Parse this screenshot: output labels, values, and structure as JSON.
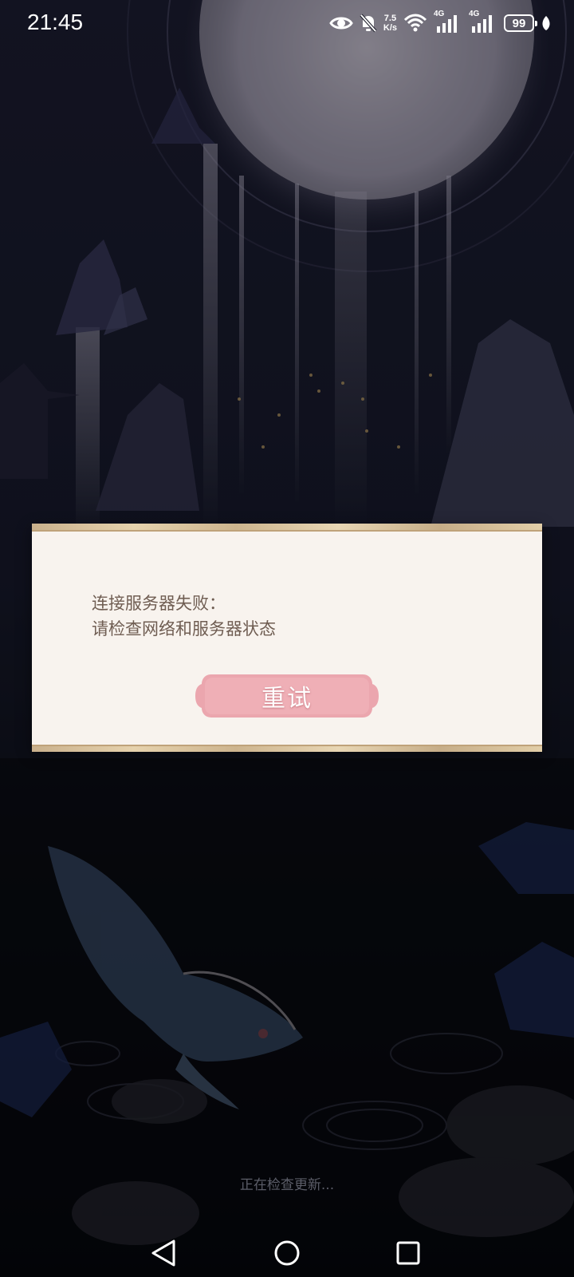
{
  "status_bar": {
    "time": "21:45",
    "network_speed_value": "7.5",
    "network_speed_unit": "K/s",
    "sim1_type": "4G",
    "sim2_type": "4G",
    "battery_level": "99",
    "icons": [
      "eye-icon",
      "mute-bell-icon",
      "wifi-icon",
      "cellular-signal-icon",
      "battery-icon",
      "leaf-icon"
    ]
  },
  "dialog": {
    "message_line1": "连接服务器失败：",
    "message_line2": "请检查网络和服务器状态",
    "retry_label": "重试"
  },
  "loading_text": "正在检查更新...",
  "navigation": {
    "icons": [
      "back-triangle-icon",
      "home-circle-icon",
      "recents-square-icon"
    ]
  },
  "colors": {
    "dialog_bg": "#f8f3ee",
    "dialog_border": "#cdb48e",
    "message_text": "#6f5d52",
    "retry_button": "#eba6ae",
    "background": "#0d0f17"
  }
}
